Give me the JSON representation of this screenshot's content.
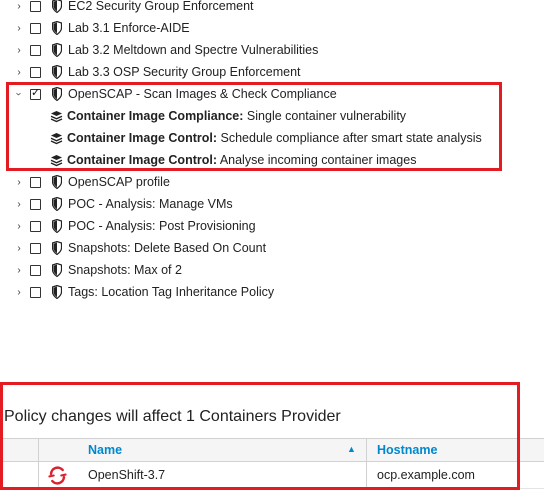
{
  "tree": {
    "items": [
      {
        "label": "EC2 Security Group Enforcement",
        "expanded": false,
        "checked": false
      },
      {
        "label": "Lab 3.1 Enforce-AIDE",
        "expanded": false,
        "checked": false
      },
      {
        "label": "Lab 3.2 Meltdown and Spectre Vulnerabilities",
        "expanded": false,
        "checked": false
      },
      {
        "label": "Lab 3.3 OSP Security Group Enforcement",
        "expanded": false,
        "checked": false
      },
      {
        "label": "OpenSCAP - Scan Images & Check Compliance",
        "expanded": true,
        "checked": true
      },
      {
        "label": "OpenSCAP profile",
        "expanded": false,
        "checked": false
      },
      {
        "label": "POC - Analysis: Manage VMs",
        "expanded": false,
        "checked": false
      },
      {
        "label": "POC - Analysis: Post Provisioning",
        "expanded": false,
        "checked": false
      },
      {
        "label": "Snapshots: Delete Based On Count",
        "expanded": false,
        "checked": false
      },
      {
        "label": "Snapshots: Max of 2",
        "expanded": false,
        "checked": false
      },
      {
        "label": "Tags: Location Tag Inheritance Policy",
        "expanded": false,
        "checked": false
      }
    ],
    "children": [
      {
        "type": "Container Image Compliance:",
        "desc": "Single container vulnerability"
      },
      {
        "type": "Container Image Control:",
        "desc": "Schedule compliance after smart state analysis"
      },
      {
        "type": "Container Image Control:",
        "desc": "Analyse incoming container images"
      }
    ]
  },
  "summary": {
    "text": "Policy changes will affect 1 Containers Provider"
  },
  "table": {
    "headers": {
      "name": "Name",
      "hostname": "Hostname"
    },
    "rows": [
      {
        "name": "OpenShift-3.7",
        "hostname": "ocp.example.com",
        "icon": "openshift-icon"
      }
    ]
  },
  "colors": {
    "highlight": "#e31b23",
    "link": "#0088ce",
    "openshift": "#db212e"
  }
}
